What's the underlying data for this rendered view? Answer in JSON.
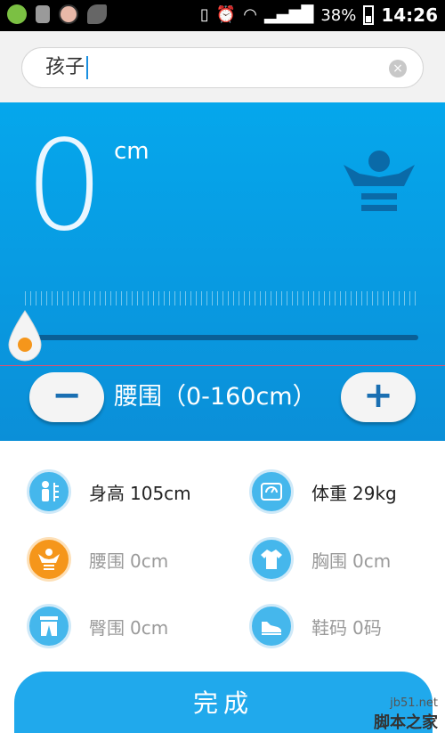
{
  "statusbar": {
    "battery": "38%",
    "time": "14:26"
  },
  "name_field": {
    "value": "孩子"
  },
  "measure": {
    "value": "0",
    "unit": "cm",
    "slider_fraction": 0,
    "range_label": "腰围（0-160cm）",
    "minus_label": "−",
    "plus_label": "+"
  },
  "stats": [
    {
      "name": "身高",
      "value": "105cm",
      "icon": "height-icon",
      "filled": true
    },
    {
      "name": "体重",
      "value": "29kg",
      "icon": "scale-icon",
      "filled": true
    },
    {
      "name": "腰围",
      "value": "0cm",
      "icon": "waist-icon",
      "filled": false
    },
    {
      "name": "胸围",
      "value": "0cm",
      "icon": "chest-icon",
      "filled": false
    },
    {
      "name": "臀围",
      "value": "0cm",
      "icon": "hip-icon",
      "filled": false
    },
    {
      "name": "鞋码",
      "value": "0码",
      "icon": "shoe-icon",
      "filled": false
    }
  ],
  "done_label": "完成",
  "watermark": {
    "site": "jb51.net",
    "name": "脚本之家"
  },
  "colors": {
    "accent": "#05a7ec",
    "orange": "#f5961b",
    "track": "#0a5f96"
  }
}
